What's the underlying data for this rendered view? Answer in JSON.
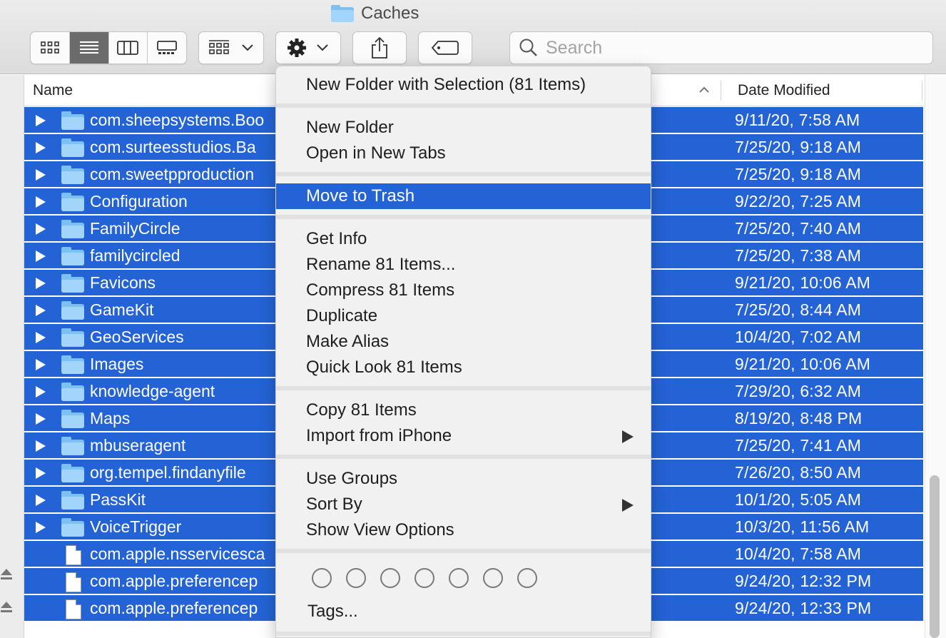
{
  "window": {
    "title": "Caches",
    "folder_icon": "folder-icon"
  },
  "toolbar": {
    "view_buttons": [
      {
        "icon": "icon-view-icon",
        "active": false
      },
      {
        "icon": "list-view-icon",
        "active": true
      },
      {
        "icon": "column-view-icon",
        "active": false
      },
      {
        "icon": "gallery-view-icon",
        "active": false
      }
    ],
    "group_button_icon": "group-grid-icon",
    "action_button_icon": "gear-icon",
    "share_button_icon": "share-icon",
    "tag_button_icon": "tag-icon",
    "search": {
      "placeholder": "Search",
      "value": ""
    }
  },
  "list": {
    "columns": {
      "name": "Name",
      "date_modified": "Date Modified"
    },
    "sort_indicator": "chevron-up-icon",
    "rows": [
      {
        "name": "com.sheepsystems.Boo",
        "date": "9/11/20, 7:58 AM",
        "kind": "folder"
      },
      {
        "name": "com.surteesstudios.Ba",
        "date": "7/25/20, 9:18 AM",
        "kind": "folder"
      },
      {
        "name": "com.sweetpproduction",
        "date": "7/25/20, 9:18 AM",
        "kind": "folder"
      },
      {
        "name": "Configuration",
        "date": "9/22/20, 7:25 AM",
        "kind": "folder"
      },
      {
        "name": "FamilyCircle",
        "date": "7/25/20, 7:40 AM",
        "kind": "folder"
      },
      {
        "name": "familycircled",
        "date": "7/25/20, 7:38 AM",
        "kind": "folder"
      },
      {
        "name": "Favicons",
        "date": "9/21/20, 10:06 AM",
        "kind": "folder"
      },
      {
        "name": "GameKit",
        "date": "7/25/20, 8:44 AM",
        "kind": "folder"
      },
      {
        "name": "GeoServices",
        "date": "10/4/20, 7:02 AM",
        "kind": "folder"
      },
      {
        "name": "Images",
        "date": "9/21/20, 10:06 AM",
        "kind": "folder"
      },
      {
        "name": "knowledge-agent",
        "date": "7/29/20, 6:32 AM",
        "kind": "folder"
      },
      {
        "name": "Maps",
        "date": "8/19/20, 8:48 PM",
        "kind": "folder"
      },
      {
        "name": "mbuseragent",
        "date": "7/25/20, 7:41 AM",
        "kind": "folder"
      },
      {
        "name": "org.tempel.findanyfile",
        "date": "7/26/20, 8:50 AM",
        "kind": "folder"
      },
      {
        "name": "PassKit",
        "date": "10/1/20, 5:05 AM",
        "kind": "folder"
      },
      {
        "name": "VoiceTrigger",
        "date": "10/3/20, 11:56 AM",
        "kind": "folder"
      },
      {
        "name": "com.apple.nsservicesca",
        "date": "10/4/20, 7:58 AM",
        "kind": "file"
      },
      {
        "name": "com.apple.preferencep",
        "date": "9/24/20, 12:32 PM",
        "kind": "file"
      },
      {
        "name": "com.apple.preferencep",
        "date": "9/24/20, 12:33 PM",
        "kind": "file"
      }
    ]
  },
  "context_menu": {
    "items": [
      {
        "label": "New Folder with Selection (81 Items)"
      },
      {
        "label": "New Folder"
      },
      {
        "label": "Open in New Tabs"
      },
      {
        "label": "Move to Trash",
        "highlighted": true
      },
      {
        "label": "Get Info"
      },
      {
        "label": "Rename 81 Items..."
      },
      {
        "label": "Compress 81 Items"
      },
      {
        "label": "Duplicate"
      },
      {
        "label": "Make Alias"
      },
      {
        "label": "Quick Look 81 Items"
      },
      {
        "label": "Copy 81 Items"
      },
      {
        "label": "Import from iPhone",
        "submenu": true
      },
      {
        "label": "Use Groups"
      },
      {
        "label": "Sort By",
        "submenu": true
      },
      {
        "label": "Show View Options"
      },
      {
        "label": "Tags..."
      }
    ],
    "tag_colors": [
      "none",
      "none",
      "none",
      "none",
      "none",
      "none",
      "none"
    ]
  },
  "colors": {
    "selection": "#2463d6",
    "folder": "#7cc0f4",
    "menu_bg": "#f1f1f1"
  }
}
